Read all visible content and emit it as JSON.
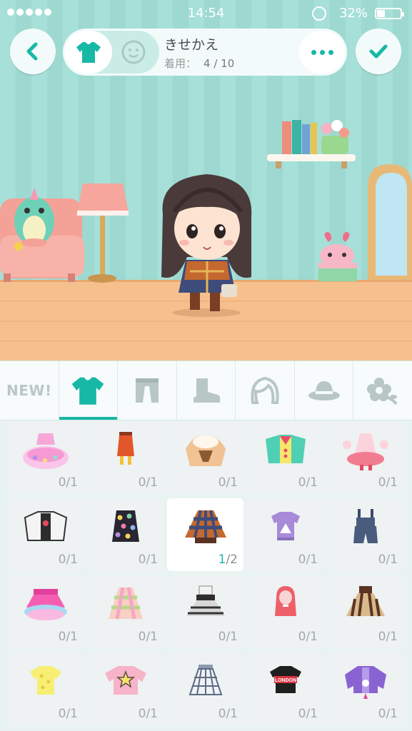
{
  "status": {
    "time": "14:54",
    "battery": "32%"
  },
  "header": {
    "title": "きせかえ",
    "worn_label": "着用：",
    "worn_value": "4 / 10"
  },
  "categories": [
    {
      "name": "new",
      "label": "NEW!"
    },
    {
      "name": "tops",
      "icon": "shirt-icon",
      "active": true
    },
    {
      "name": "bottoms",
      "icon": "pants-icon"
    },
    {
      "name": "shoes",
      "icon": "boot-icon"
    },
    {
      "name": "hair",
      "icon": "hair-icon"
    },
    {
      "name": "hat",
      "icon": "hat-icon"
    },
    {
      "name": "accessory",
      "icon": "flower-icon"
    }
  ],
  "items": [
    {
      "icon": "pink-tutu-dress-icon",
      "count": "0/1"
    },
    {
      "icon": "orange-skirt-icon",
      "count": "0/1"
    },
    {
      "icon": "fur-cape-icon",
      "count": "0/1"
    },
    {
      "icon": "clown-jacket-icon",
      "count": "0/1"
    },
    {
      "icon": "lolita-dress-icon",
      "count": "0/1"
    },
    {
      "icon": "black-white-coat-icon",
      "count": "0/1"
    },
    {
      "icon": "polka-dress-icon",
      "count": "0/1"
    },
    {
      "icon": "plaid-poncho-icon",
      "count": "1/2",
      "owned": "1",
      "total": "/2",
      "selected": true
    },
    {
      "icon": "purple-sweater-icon",
      "count": "0/1"
    },
    {
      "icon": "denim-overalls-icon",
      "count": "0/1"
    },
    {
      "icon": "pink-skirt-icon",
      "count": "0/1"
    },
    {
      "icon": "pastel-check-dress-icon",
      "count": "0/1"
    },
    {
      "icon": "grey-tiered-dress-icon",
      "count": "0/1"
    },
    {
      "icon": "red-hoodie-icon",
      "count": "0/1"
    },
    {
      "icon": "brown-dress-icon",
      "count": "0/1"
    },
    {
      "icon": "yellow-star-tee-icon",
      "count": "0/1"
    },
    {
      "icon": "pink-star-sweater-icon",
      "count": "0/1"
    },
    {
      "icon": "grid-skirt-icon",
      "count": "0/1"
    },
    {
      "icon": "london-tee-icon",
      "count": "0/1",
      "text": "LONDON"
    },
    {
      "icon": "purple-jacket-icon",
      "count": "0/1"
    }
  ]
}
